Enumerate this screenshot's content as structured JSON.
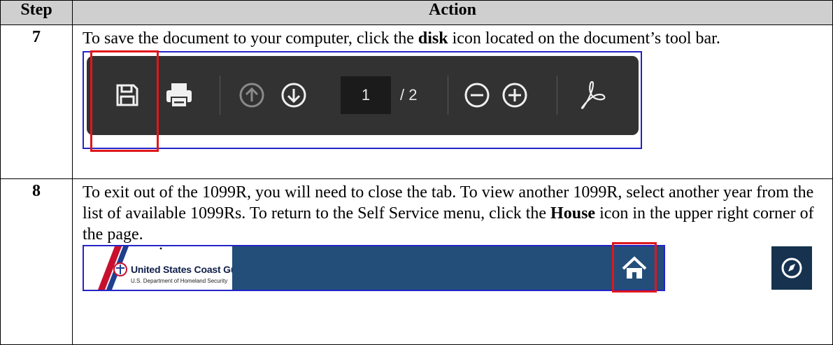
{
  "table": {
    "header_step": "Step",
    "header_action": "Action"
  },
  "rows": [
    {
      "step": "7",
      "text_before": "To save the document to your computer, click the ",
      "bold": "disk",
      "text_after": " icon located on the document’s tool bar."
    },
    {
      "step": "8",
      "text_1": "To exit out of the 1099R, you will need to close the tab.  To view another 1099R, select another year from the list of available 1099Rs.  To return to the Self Service menu, click the ",
      "bold": "House",
      "text_2": " icon in the upper right corner of the page."
    }
  ],
  "pdf_toolbar": {
    "current_page": "1",
    "total_pages": "/ 2",
    "icons": [
      "save-disk-icon",
      "print-icon",
      "page-up-icon",
      "page-down-icon",
      "zoom-out-icon",
      "zoom-in-icon",
      "adobe-acrobat-icon"
    ],
    "highlight_color": "#e0161b",
    "background_color": "#323232"
  },
  "cg_header": {
    "org_name": "United States Coast Guard",
    "org_subtitle": "U.S. Department of Homeland Security",
    "icons": [
      "home-icon",
      "flag-icon",
      "more-vertical-icon",
      "compass-icon"
    ],
    "bar_color": "#234e79"
  }
}
